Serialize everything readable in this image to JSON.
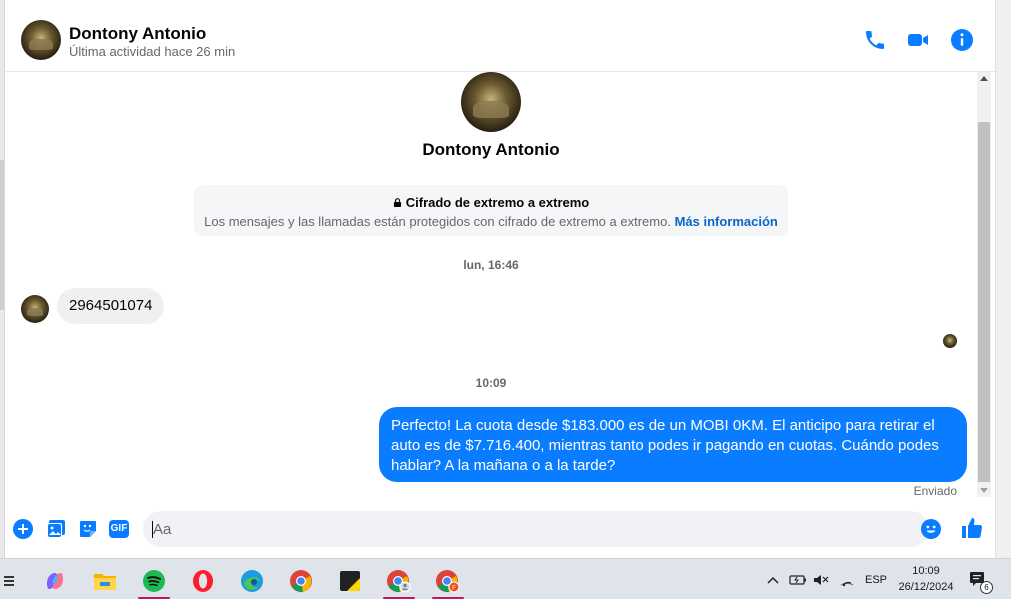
{
  "header": {
    "name": "Dontony Antonio",
    "status": "Última actividad hace 26 min",
    "call_icon": "phone-icon",
    "video_icon": "video-icon",
    "info_icon": "info-icon"
  },
  "profile": {
    "name": "Dontony Antonio"
  },
  "encryption": {
    "title": "Cifrado de extremo a extremo",
    "description": "Los mensajes y las llamadas están protegidos con cifrado de extremo a extremo.",
    "link": "Más información"
  },
  "messages": {
    "timestamp_1": "lun, 16:46",
    "incoming_1": "2964501074",
    "timestamp_2": "10:09",
    "outgoing_1": "Perfecto! La cuota desde $183.000 es de un MOBI 0KM. El anticipo para retirar el auto es de $7.716.400, mientras tanto podes ir pagando en cuotas. Cuándo podes hablar? A la mañana o a la tarde?",
    "sent_status": "Enviado"
  },
  "composer": {
    "placeholder": "Aa",
    "value": "",
    "gif_label": "GIF"
  },
  "taskbar": {
    "apps": [
      "copilot-icon",
      "file-explorer-icon",
      "spotify-icon",
      "opera-icon",
      "edge-icon",
      "chrome-icon",
      "sticky-notes-icon",
      "chrome-profile-icon",
      "chrome-profile-2-icon"
    ],
    "language": "ESP",
    "time": "10:09",
    "date": "26/12/2024",
    "notification_count": "6"
  },
  "colors": {
    "accent": "#0a7cff",
    "outgoing_bubble": "#0a7cff",
    "incoming_bubble": "#f0f0f0",
    "taskbar": "#dfe3ea"
  }
}
